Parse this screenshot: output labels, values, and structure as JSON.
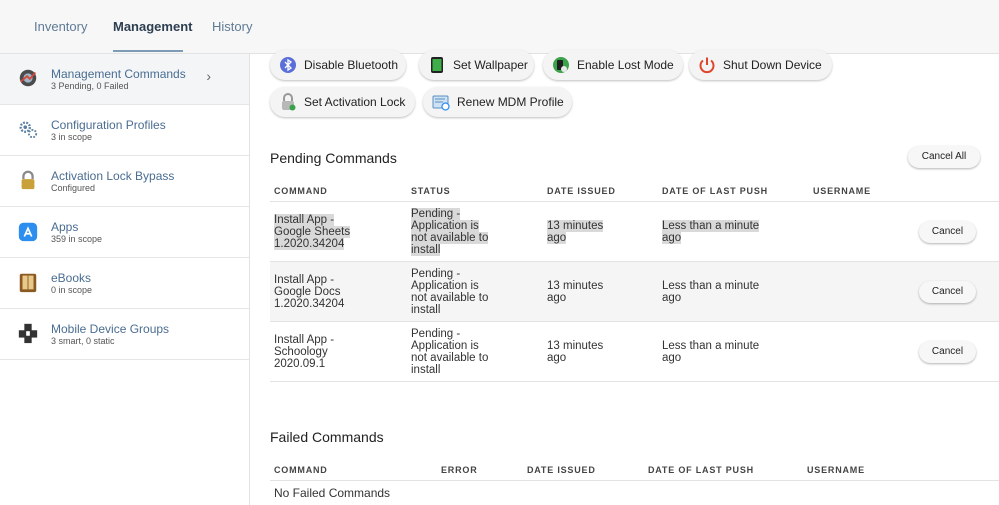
{
  "tabs": [
    {
      "label": "Inventory"
    },
    {
      "label": "Management"
    },
    {
      "label": "History"
    }
  ],
  "sidebar": {
    "items": [
      {
        "title": "Management Commands",
        "sub": "3 Pending, 0 Failed",
        "icon": "management-commands-icon"
      },
      {
        "title": "Configuration Profiles",
        "sub": "3 in scope",
        "icon": "gears-icon"
      },
      {
        "title": "Activation Lock Bypass",
        "sub": "Configured",
        "icon": "padlock-icon"
      },
      {
        "title": "Apps",
        "sub": "359 in scope",
        "icon": "app-store-icon"
      },
      {
        "title": "eBooks",
        "sub": "0 in scope",
        "icon": "book-icon"
      },
      {
        "title": "Mobile Device Groups",
        "sub": "3 smart, 0 static",
        "icon": "device-group-icon"
      }
    ]
  },
  "commands": [
    {
      "label": "Disable Bluetooth",
      "icon": "bluetooth-icon"
    },
    {
      "label": "Set Wallpaper",
      "icon": "wallpaper-icon"
    },
    {
      "label": "Enable Lost Mode",
      "icon": "lost-mode-icon"
    },
    {
      "label": "Shut Down Device",
      "icon": "power-icon"
    },
    {
      "label": "Set Activation Lock",
      "icon": "activation-lock-icon"
    },
    {
      "label": "Renew MDM Profile",
      "icon": "mdm-profile-icon"
    }
  ],
  "pending": {
    "title": "Pending Commands",
    "cancel_all": "Cancel All",
    "headers": [
      "COMMAND",
      "STATUS",
      "DATE ISSUED",
      "DATE OF LAST PUSH",
      "USERNAME"
    ],
    "rows": [
      {
        "command": [
          "Install App -",
          "Google Sheets",
          "1.2020.34204"
        ],
        "status": [
          "Pending -",
          "Application is",
          "not available to",
          "install"
        ],
        "issued": [
          "13 minutes",
          "ago"
        ],
        "push": [
          "Less than a minute",
          "ago"
        ],
        "username": "",
        "cancel": "Cancel"
      },
      {
        "command": [
          "Install App -",
          "Google Docs",
          "1.2020.34204"
        ],
        "status": [
          "Pending -",
          "Application is",
          "not available to",
          "install"
        ],
        "issued": [
          "13 minutes",
          "ago"
        ],
        "push": [
          "Less than a minute",
          "ago"
        ],
        "username": "",
        "cancel": "Cancel"
      },
      {
        "command": [
          "Install App -",
          "Schoology",
          "2020.09.1"
        ],
        "status": [
          "Pending -",
          "Application is",
          "not available to",
          "install"
        ],
        "issued": [
          "13 minutes",
          "ago"
        ],
        "push": [
          "Less than a minute",
          "ago"
        ],
        "username": "",
        "cancel": "Cancel"
      }
    ]
  },
  "failed": {
    "title": "Failed Commands",
    "headers": [
      "COMMAND",
      "ERROR",
      "DATE ISSUED",
      "DATE OF LAST PUSH",
      "USERNAME"
    ],
    "empty": "No Failed Commands"
  },
  "colors": {
    "link": "#4a6d91",
    "power": "#e0452c",
    "bluetooth": "#5b6fd8"
  }
}
